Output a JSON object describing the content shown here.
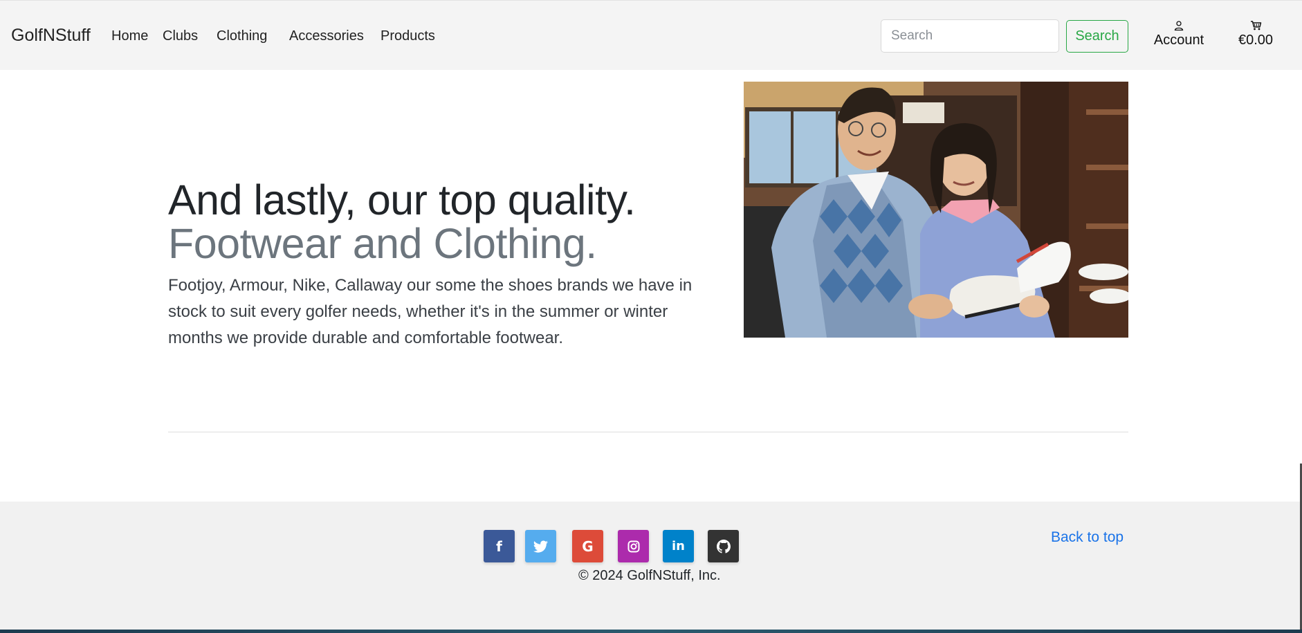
{
  "navbar": {
    "brand": "GolfNStuff",
    "links": [
      {
        "label": "Home"
      },
      {
        "label": "Clubs"
      },
      {
        "label": "Clothing"
      },
      {
        "label": "Accessories"
      },
      {
        "label": "Products"
      }
    ],
    "search": {
      "placeholder": "Search",
      "value": "",
      "button_label": "Search"
    },
    "account_label": "Account",
    "cart_total": "€0.00"
  },
  "hero": {
    "heading": "And lastly, our top quality.",
    "subheading": "Footwear and Clothing.",
    "lead": "Footjoy, Armour, Nike, Callaway our some the shoes brands we have in stock to suit every golfer needs, whether it's in the summer or winter months we provide durable and comfortable footwear."
  },
  "footer": {
    "social": [
      {
        "icon": "facebook-icon",
        "glyph": "f",
        "color": "#3b5998"
      },
      {
        "icon": "twitter-icon",
        "glyph": "t",
        "color": "#55acee"
      },
      {
        "icon": "google-icon",
        "glyph": "G",
        "color": "#dd4b39"
      },
      {
        "icon": "instagram-icon",
        "glyph": "◎",
        "color": "#ac2bac"
      },
      {
        "icon": "linkedin-icon",
        "glyph": "in",
        "color": "#0082ca"
      },
      {
        "icon": "github-icon",
        "glyph": "●",
        "color": "#333333"
      }
    ],
    "back_to_top": "Back to top",
    "copyright": "© 2024 GolfNStuff, Inc."
  },
  "colors": {
    "navbar_bg": "#f4f4f4",
    "search_button": "#28a745",
    "link": "#1a73e8",
    "footer_bg": "#f1f1f1"
  }
}
